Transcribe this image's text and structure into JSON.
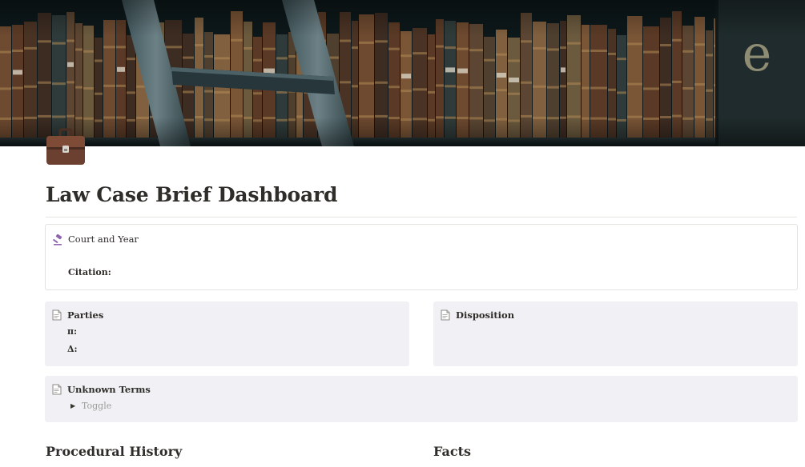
{
  "page": {
    "title": "Law Case Brief Dashboard",
    "cover_image": "library-bookshelf-cover",
    "page_icon": "briefcase-icon"
  },
  "court_callout": {
    "icon": "gavel-icon",
    "label": "Court and Year",
    "citation_label": "Citation:"
  },
  "parties_callout": {
    "icon": "document-icon",
    "label": "Parties",
    "plaintiff_label": "π:",
    "defendant_label": "Δ:"
  },
  "disposition_callout": {
    "icon": "document-icon",
    "label": "Disposition"
  },
  "unknown_terms_callout": {
    "icon": "document-icon",
    "label": "Unknown Terms",
    "toggle_label": "Toggle"
  },
  "sections": {
    "procedural_history": "Procedural History",
    "facts": "Facts"
  },
  "colors": {
    "callout_grey": "#f1f1f5",
    "text": "#37352f",
    "gavel": "#9065b0",
    "muted": "#9b9a97"
  }
}
